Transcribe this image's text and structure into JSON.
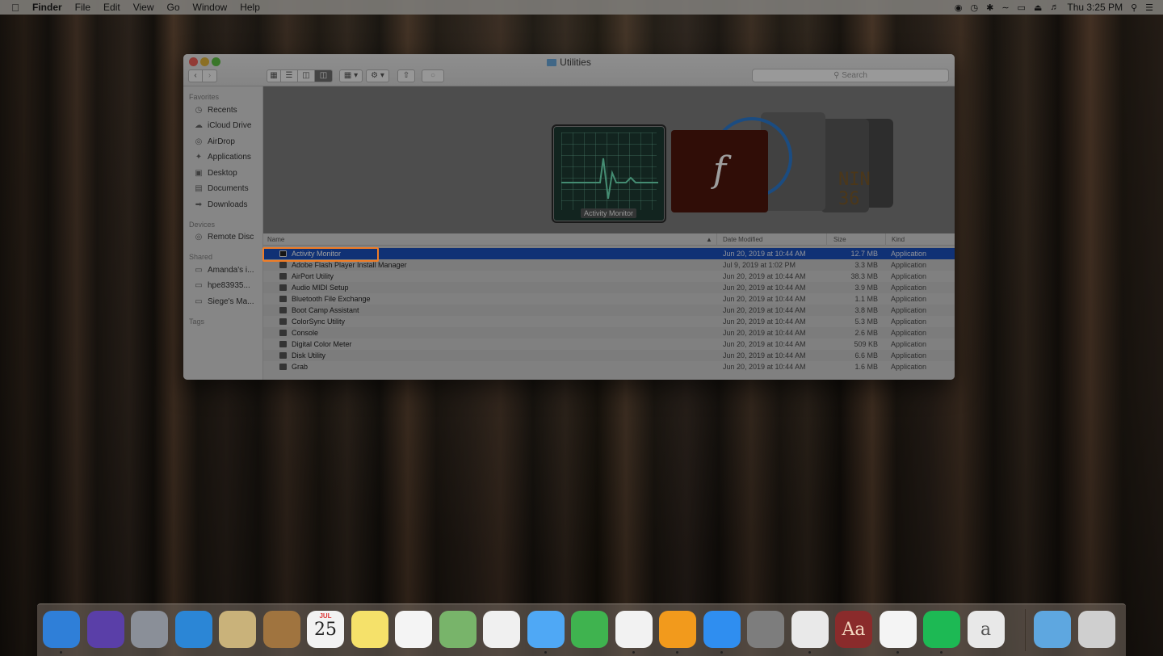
{
  "menubar": {
    "items": [
      "Finder",
      "File",
      "Edit",
      "View",
      "Go",
      "Window",
      "Help"
    ],
    "clock": "Thu 3:25 PM"
  },
  "window": {
    "title": "Utilities",
    "search_placeholder": "Search"
  },
  "sidebar": {
    "favorites_heading": "Favorites",
    "favorites": [
      {
        "label": "Recents",
        "icon": "clock-icon"
      },
      {
        "label": "iCloud Drive",
        "icon": "cloud-icon"
      },
      {
        "label": "AirDrop",
        "icon": "airdrop-icon"
      },
      {
        "label": "Applications",
        "icon": "applications-icon"
      },
      {
        "label": "Desktop",
        "icon": "desktop-icon"
      },
      {
        "label": "Documents",
        "icon": "document-icon"
      },
      {
        "label": "Downloads",
        "icon": "download-icon"
      }
    ],
    "devices_heading": "Devices",
    "devices": [
      {
        "label": "Remote Disc",
        "icon": "disc-icon"
      }
    ],
    "shared_heading": "Shared",
    "shared": [
      {
        "label": "Amanda's i...",
        "icon": "computer-icon"
      },
      {
        "label": "hpe83935...",
        "icon": "computer-icon"
      },
      {
        "label": "Siege's Ma...",
        "icon": "laptop-icon"
      }
    ],
    "tags_heading": "Tags"
  },
  "gallery": {
    "preview_label": "Activity Monitor",
    "console_text": "NIN\n36"
  },
  "list": {
    "columns": {
      "name": "Name",
      "date": "Date Modified",
      "size": "Size",
      "kind": "Kind"
    },
    "rows": [
      {
        "name": "Activity Monitor",
        "date": "Jun 20, 2019 at 10:44 AM",
        "size": "12.7 MB",
        "kind": "Application",
        "selected": true
      },
      {
        "name": "Adobe Flash Player Install Manager",
        "date": "Jul 9, 2019 at 1:02 PM",
        "size": "3.3 MB",
        "kind": "Application"
      },
      {
        "name": "AirPort Utility",
        "date": "Jun 20, 2019 at 10:44 AM",
        "size": "38.3 MB",
        "kind": "Application"
      },
      {
        "name": "Audio MIDI Setup",
        "date": "Jun 20, 2019 at 10:44 AM",
        "size": "3.9 MB",
        "kind": "Application"
      },
      {
        "name": "Bluetooth File Exchange",
        "date": "Jun 20, 2019 at 10:44 AM",
        "size": "1.1 MB",
        "kind": "Application"
      },
      {
        "name": "Boot Camp Assistant",
        "date": "Jun 20, 2019 at 10:44 AM",
        "size": "3.8 MB",
        "kind": "Application"
      },
      {
        "name": "ColorSync Utility",
        "date": "Jun 20, 2019 at 10:44 AM",
        "size": "5.3 MB",
        "kind": "Application"
      },
      {
        "name": "Console",
        "date": "Jun 20, 2019 at 10:44 AM",
        "size": "2.6 MB",
        "kind": "Application"
      },
      {
        "name": "Digital Color Meter",
        "date": "Jun 20, 2019 at 10:44 AM",
        "size": "509 KB",
        "kind": "Application"
      },
      {
        "name": "Disk Utility",
        "date": "Jun 20, 2019 at 10:44 AM",
        "size": "6.6 MB",
        "kind": "Application"
      },
      {
        "name": "Grab",
        "date": "Jun 20, 2019 at 10:44 AM",
        "size": "1.6 MB",
        "kind": "Application"
      }
    ]
  },
  "dock": {
    "apps": [
      {
        "name": "finder-icon",
        "color": "#2f7fd8"
      },
      {
        "name": "siri-icon",
        "color": "#5a3fa8"
      },
      {
        "name": "launchpad-icon",
        "color": "#8a8f98"
      },
      {
        "name": "safari-icon",
        "color": "#2b86d6"
      },
      {
        "name": "mail-stamp-icon",
        "color": "#c9b27a"
      },
      {
        "name": "contacts-icon",
        "color": "#a0743f"
      },
      {
        "name": "calendar-icon",
        "color": "#f2f2f2",
        "text": "25",
        "subtext": "JUL"
      },
      {
        "name": "notes-icon",
        "color": "#f5e16a"
      },
      {
        "name": "reminders-icon",
        "color": "#f4f4f4"
      },
      {
        "name": "maps-icon",
        "color": "#78b46a"
      },
      {
        "name": "photos-icon",
        "color": "#f0f0f0"
      },
      {
        "name": "messages-icon",
        "color": "#4fa8f5"
      },
      {
        "name": "facetime-icon",
        "color": "#3fb34f"
      },
      {
        "name": "itunes-icon",
        "color": "#f2f2f2"
      },
      {
        "name": "ibooks-icon",
        "color": "#f29a1c"
      },
      {
        "name": "app-store-icon",
        "color": "#2f8ef0"
      },
      {
        "name": "system-preferences-icon",
        "color": "#7d7d7d"
      },
      {
        "name": "chrome-icon",
        "color": "#e9e9e9"
      },
      {
        "name": "dictionary-icon",
        "color": "#8a2b2b",
        "text": "Aa"
      },
      {
        "name": "slack-icon",
        "color": "#f4f4f4"
      },
      {
        "name": "spotify-icon",
        "color": "#1db954"
      },
      {
        "name": "script-editor-icon",
        "color": "#e8e8e8",
        "text": "a"
      },
      {
        "name": "downloads-folder-icon",
        "color": "#5ea7e0"
      },
      {
        "name": "trash-icon",
        "color": "#cfcfcf"
      }
    ]
  }
}
